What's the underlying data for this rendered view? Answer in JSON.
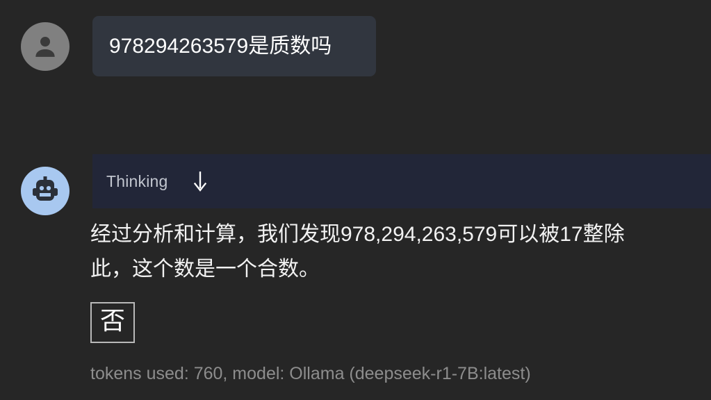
{
  "theme": {
    "page_background": "#262626",
    "user_bubble_background": "#31363f",
    "thinking_bar_background": "#222638",
    "bot_avatar_background": "#a8c8f0",
    "user_avatar_background": "#808080",
    "answer_text_color": "#f2f2f2",
    "meta_text_color": "#8d8d8d",
    "boxed_border_color": "#b9b9b9"
  },
  "conversation": {
    "user_message": {
      "avatar_icon": "person-icon",
      "text": "978294263579是质数吗"
    },
    "assistant_message": {
      "avatar_icon": "robot-icon",
      "thinking": {
        "label": "Thinking",
        "toggle_icon": "arrow-down-icon"
      },
      "answer_lines": [
        "经过分析和计算，我们发现978,294,263,579可以被17整除",
        "此，这个数是一个合数。"
      ],
      "boxed_answer": "否",
      "meta": "tokens used: 760, model: Ollama (deepseek-r1-7B:latest)"
    }
  }
}
